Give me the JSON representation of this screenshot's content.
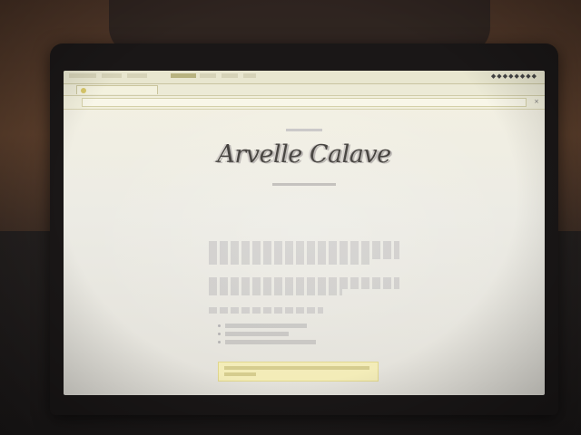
{
  "page": {
    "title": "Arvelle Calave"
  },
  "colors": {
    "screen_bg": "#efede4",
    "menubar": "#e8e6cf",
    "footer_note": "#f3ecb8",
    "title_text": "#3a3733"
  },
  "icons": {
    "tab_favicon": "page-icon",
    "close_tab": "close-icon"
  }
}
